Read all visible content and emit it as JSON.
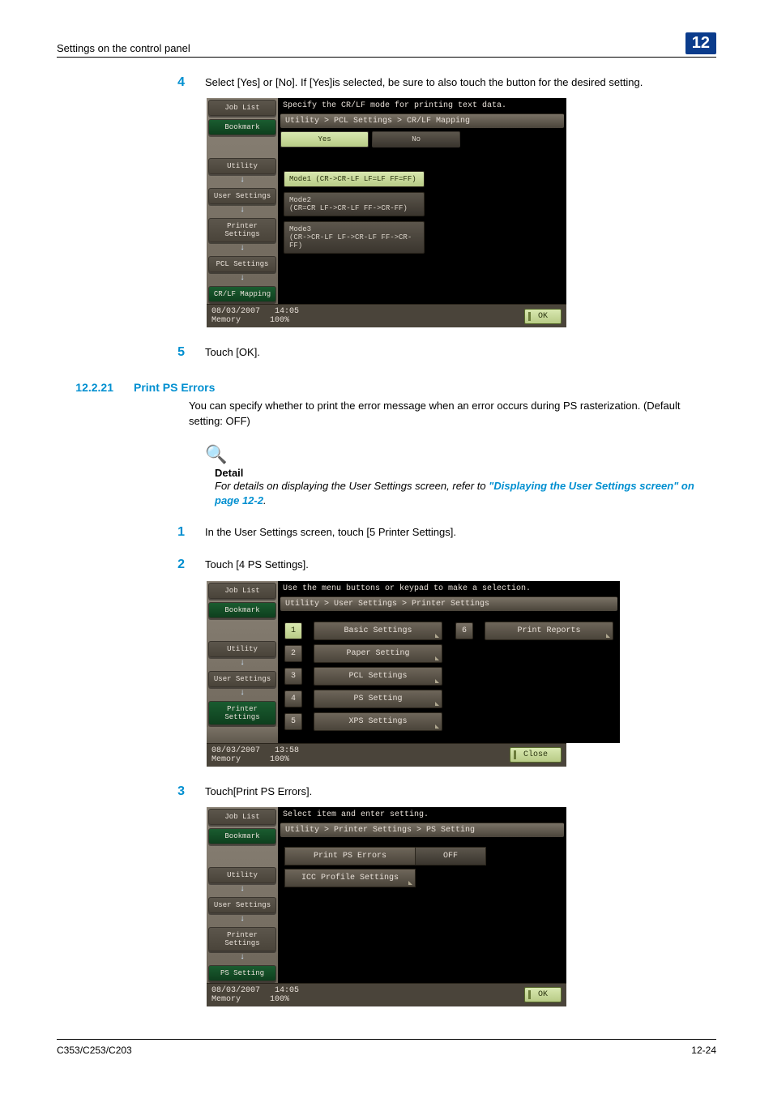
{
  "header": {
    "title": "Settings on the control panel",
    "chapter": "12"
  },
  "steps": {
    "s4": {
      "num": "4",
      "text": "Select [Yes] or [No]. If [Yes]is selected, be sure to also touch the button for the desired setting."
    },
    "s5": {
      "num": "5",
      "text": "Touch [OK]."
    }
  },
  "section": {
    "num": "12.2.21",
    "title": "Print PS Errors",
    "body": "You can specify whether to print the error message when an error occurs during PS rasterization. (Default setting: OFF)"
  },
  "detail": {
    "label": "Detail",
    "body_pre": "For details on displaying the User Settings screen, refer to ",
    "link": "\"Displaying the User Settings screen\" on page 12-2",
    "body_post": "."
  },
  "steps2": {
    "s1": {
      "num": "1",
      "text": "In the User Settings screen, touch [5 Printer Settings]."
    },
    "s2": {
      "num": "2",
      "text": "Touch [4 PS Settings]."
    },
    "s3": {
      "num": "3",
      "text": "Touch[Print PS Errors]."
    }
  },
  "panel1": {
    "side": {
      "job_list": "Job List",
      "bookmark": "Bookmark",
      "utility": "Utility",
      "user_settings": "User Settings",
      "printer_settings": "Printer Settings",
      "pcl_settings": "PCL Settings",
      "crlf": "CR/LF Mapping"
    },
    "prompt": "Specify the CR/LF mode for printing text data.",
    "breadcrumb": "Utility > PCL Settings > CR/LF Mapping",
    "tabs": {
      "yes": "Yes",
      "no": "No"
    },
    "modes": {
      "m1": "Mode1 (CR->CR-LF LF=LF FF=FF)",
      "m2": "Mode2\n(CR=CR LF->CR-LF FF->CR-FF)",
      "m3": "Mode3\n(CR->CR-LF LF->CR-LF FF->CR-FF)"
    },
    "footer": {
      "date": "08/03/2007",
      "time": "14:05",
      "mem": "Memory",
      "pct": "100%",
      "ok": "OK"
    }
  },
  "panel2": {
    "side": {
      "job_list": "Job List",
      "bookmark": "Bookmark",
      "utility": "Utility",
      "user_settings": "User Settings",
      "printer_settings": "Printer Settings"
    },
    "prompt": "Use the menu buttons or keypad to make a selection.",
    "breadcrumb": "Utility > User Settings > Printer Settings",
    "menu": {
      "i1": {
        "n": "1",
        "label": "Basic Settings"
      },
      "i2": {
        "n": "2",
        "label": "Paper Setting"
      },
      "i3": {
        "n": "3",
        "label": "PCL Settings"
      },
      "i4": {
        "n": "4",
        "label": "PS Setting"
      },
      "i5": {
        "n": "5",
        "label": "XPS Settings"
      },
      "i6": {
        "n": "6",
        "label": "Print Reports"
      }
    },
    "footer": {
      "date": "08/03/2007",
      "time": "13:58",
      "mem": "Memory",
      "pct": "100%",
      "close": "Close"
    }
  },
  "panel3": {
    "side": {
      "job_list": "Job List",
      "bookmark": "Bookmark",
      "utility": "Utility",
      "user_settings": "User Settings",
      "printer_settings": "Printer Settings",
      "ps_setting": "PS Setting"
    },
    "prompt": "Select item and enter setting.",
    "breadcrumb": "Utility > Printer Settings > PS Setting",
    "items": {
      "pps": "Print PS Errors",
      "pps_val": "OFF",
      "icc": "ICC Profile Settings"
    },
    "footer": {
      "date": "08/03/2007",
      "time": "14:05",
      "mem": "Memory",
      "pct": "100%",
      "ok": "OK"
    }
  },
  "footer": {
    "model": "C353/C253/C203",
    "page": "12-24"
  }
}
